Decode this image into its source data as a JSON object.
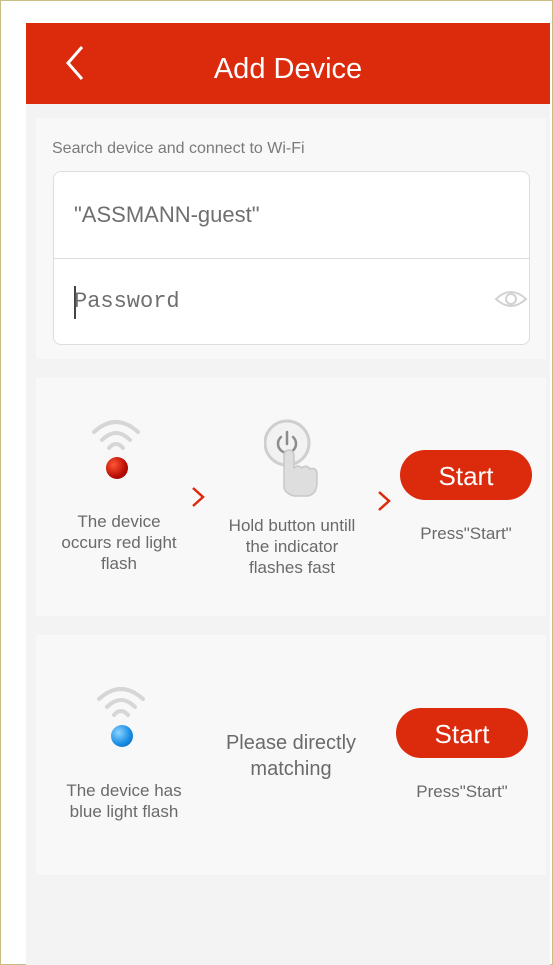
{
  "header": {
    "title": "Add Device"
  },
  "wifi": {
    "section_title": "Search device and connect to Wi-Fi",
    "ssid": "\"ASSMANN-guest\"",
    "password_placeholder": "Password"
  },
  "steps_red": {
    "device_label": "The device occurs red light flash",
    "hold_label": "Hold button untill the indicator flashes fast",
    "start_label": "Start",
    "press_label": "Press\"Start\""
  },
  "steps_blue": {
    "device_label": "The device has blue light flash",
    "direct_label": "Please directly matching",
    "start_label": "Start",
    "press_label": "Press\"Start\""
  },
  "colors": {
    "brand_red": "#dc2a0c",
    "indicator_red": "#b80d05",
    "indicator_blue": "#1b8fe6"
  },
  "icons": [
    "back-arrow-icon",
    "eye-icon",
    "wifi-icon",
    "power-button-hand-icon",
    "chevron-right-icon"
  ]
}
